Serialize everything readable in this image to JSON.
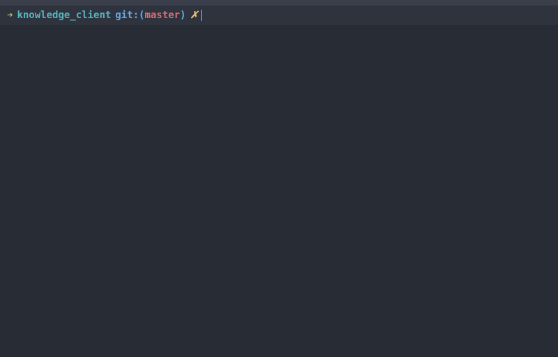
{
  "prompt": {
    "arrow": "➜",
    "cwd": "knowledge_client",
    "git_label": "git:",
    "paren_open": "(",
    "branch": "master",
    "paren_close": ")",
    "dirty_mark": "✗"
  },
  "colors": {
    "bg": "#282c34",
    "bg_prompt": "#2f333d",
    "arrow": "#98c379",
    "cwd": "#56b6c2",
    "git": "#61afef",
    "branch": "#e06c75",
    "dirty": "#e5c07b",
    "cursor": "#abb2bf"
  }
}
